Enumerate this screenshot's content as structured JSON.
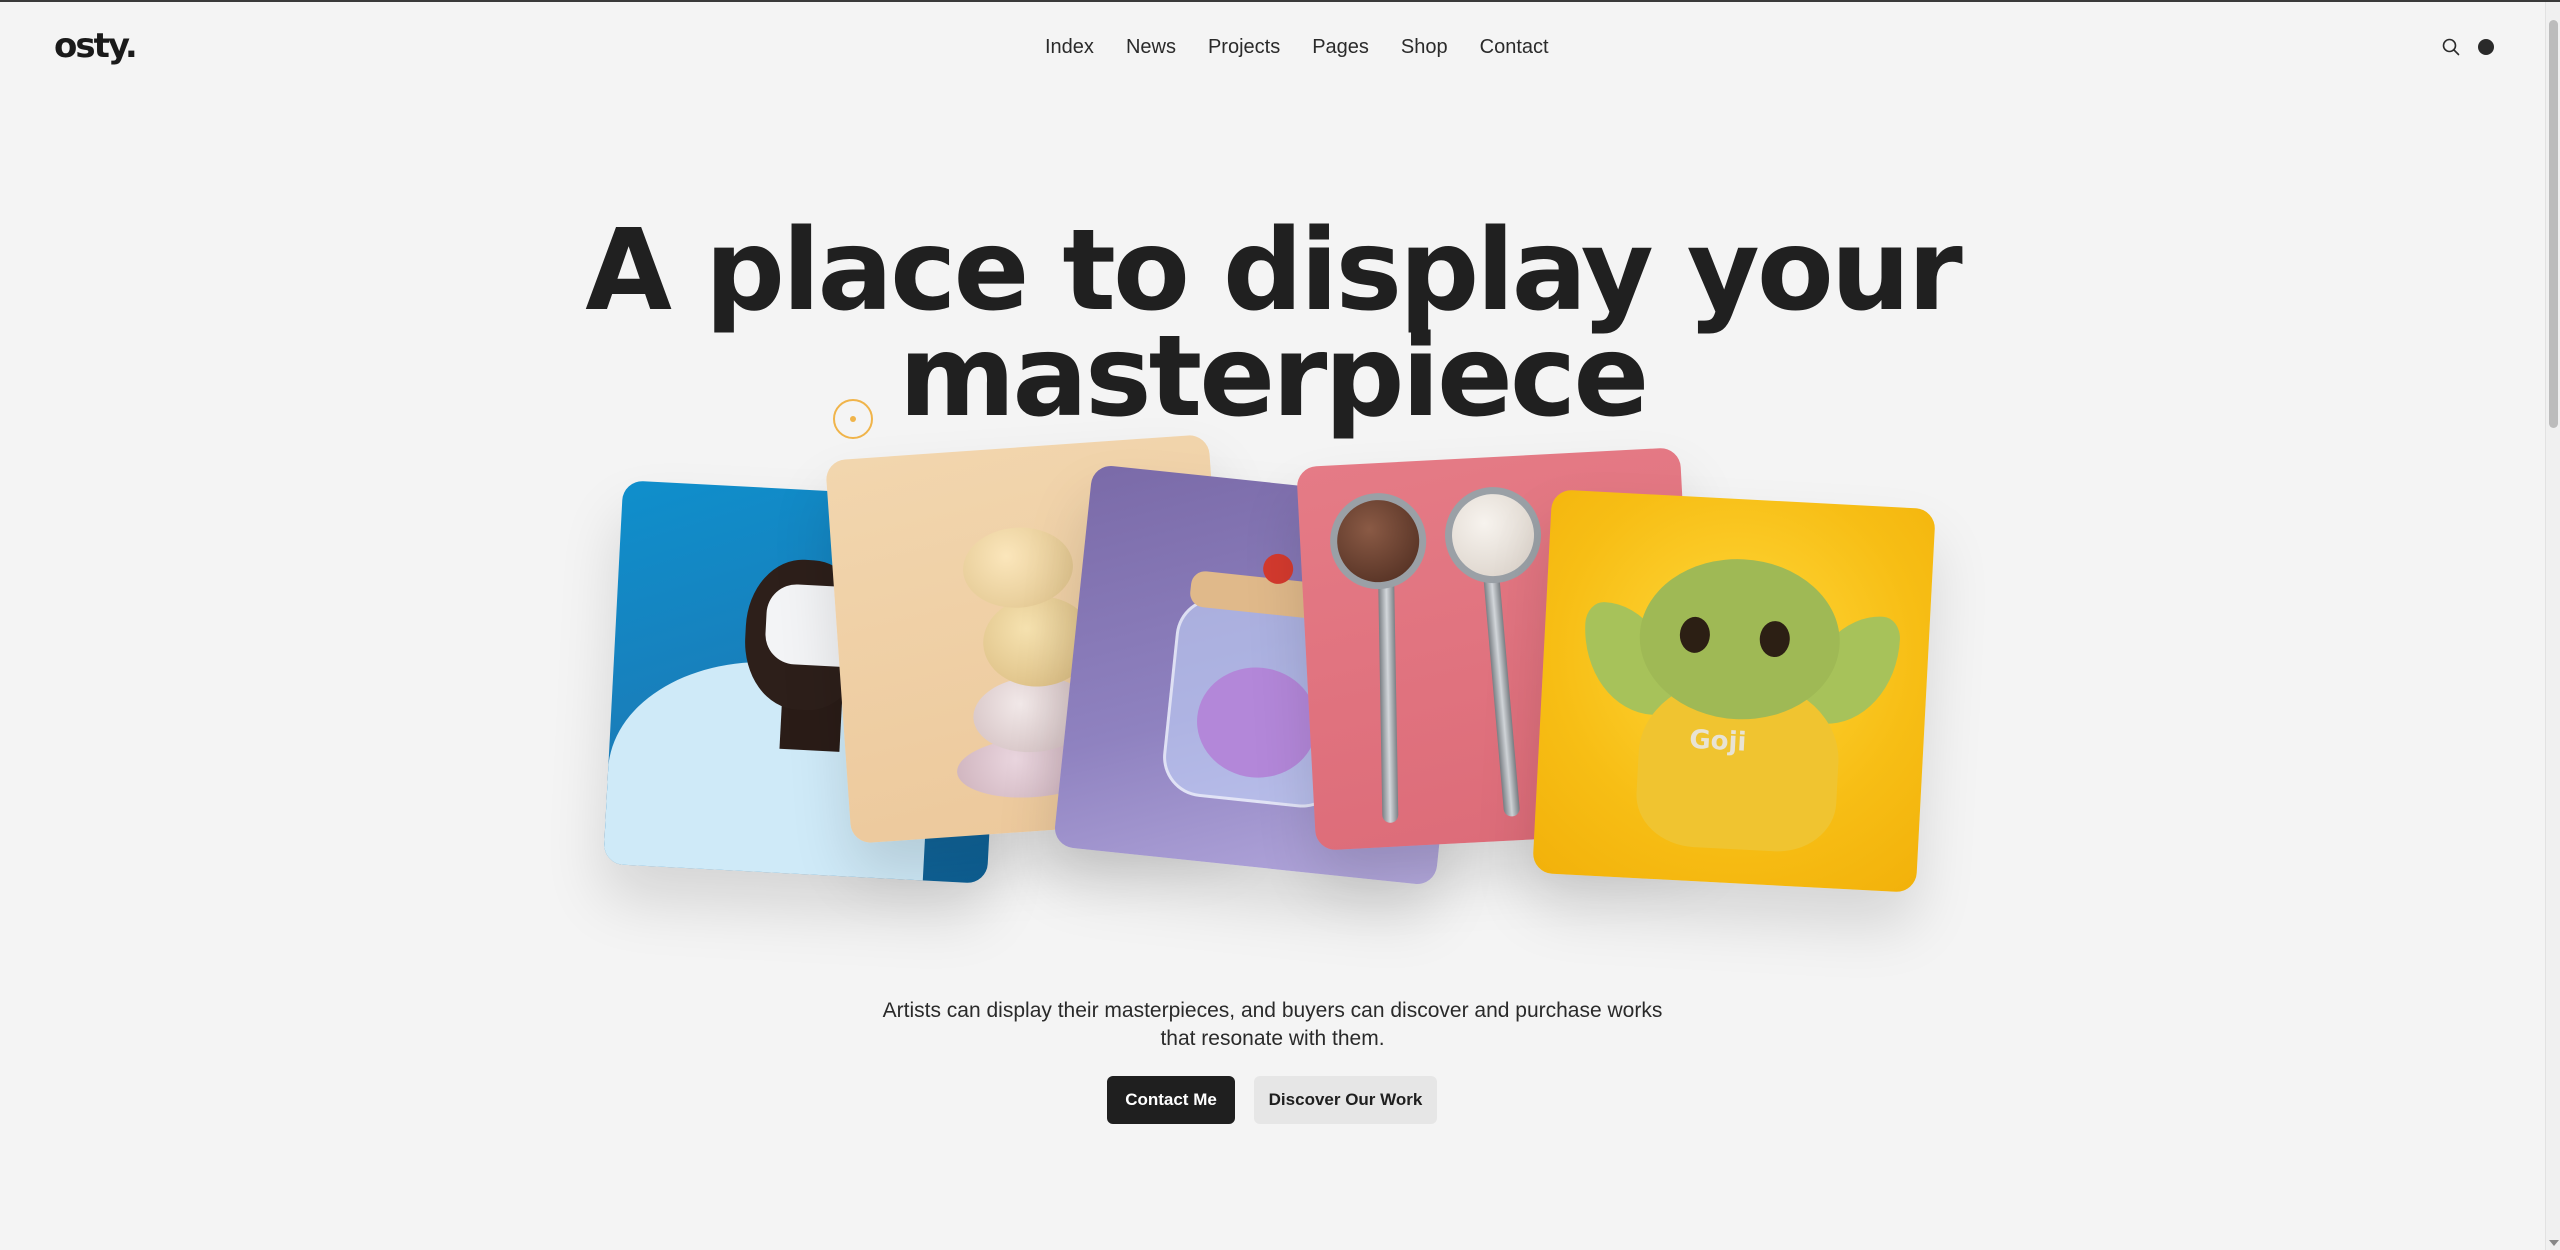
{
  "header": {
    "logo": "osty.",
    "nav": [
      "Index",
      "News",
      "Projects",
      "Pages",
      "Shop",
      "Contact"
    ],
    "icons": [
      "search-icon",
      "theme-toggle-icon"
    ]
  },
  "hero": {
    "title_line1": "A place to display your",
    "title_line2": "masterpiece",
    "description_line1": "Artists can display their masterpieces, and buyers can discover and purchase works",
    "description_line2": "that resonate with them.",
    "primary_button": "Contact Me",
    "secondary_button": "Discover Our Work"
  },
  "gallery": {
    "cards": [
      {
        "subject": "person wearing VR headset",
        "color": "#1a7cb8"
      },
      {
        "subject": "stacked pebbles",
        "color": "#ecc89b"
      },
      {
        "subject": "cute creature in a glass jar",
        "color": "#8f82c0"
      },
      {
        "subject": "ice cream scoops on spoons",
        "color": "#dc6b78"
      },
      {
        "subject": "baby dragon in yellow hoodie",
        "color": "#f7be15",
        "text": "Goji"
      }
    ]
  },
  "colors": {
    "background": "#f4f4f4",
    "text": "#202020",
    "accent_cursor": "#f0b44a",
    "button_dark": "#1f1f1f",
    "button_light": "#e6e6e6"
  }
}
